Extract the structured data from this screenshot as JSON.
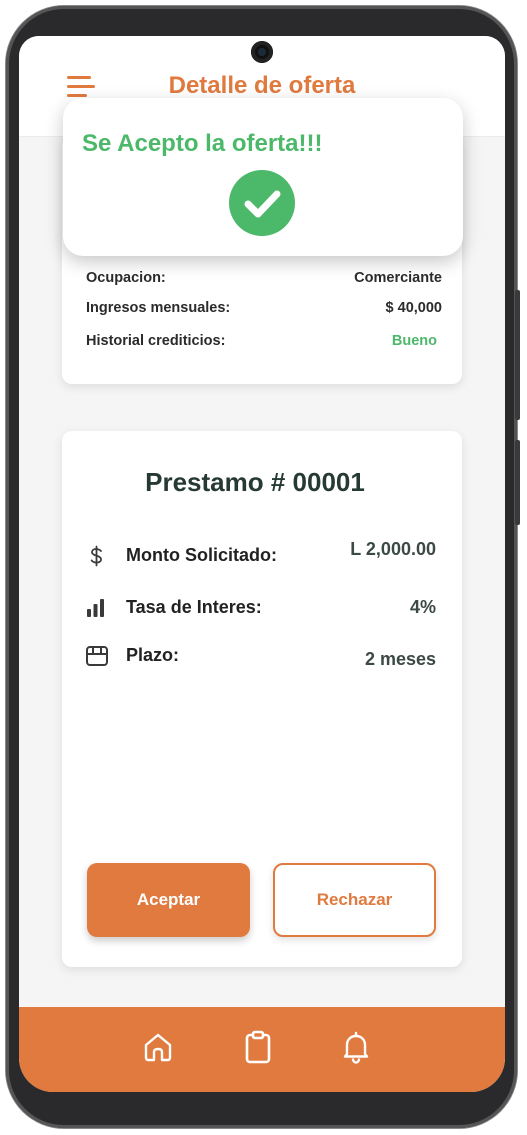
{
  "header": {
    "title": "Detalle de oferta"
  },
  "toast": {
    "message": "Se Acepto la oferta!!!"
  },
  "applicant": {
    "rows": [
      {
        "label": "Ocupacion:",
        "value": "Comerciante"
      },
      {
        "label": "Ingresos mensuales:",
        "value": "$ 40,000"
      },
      {
        "label": "Historial crediticios:",
        "value": "Bueno"
      }
    ]
  },
  "loan": {
    "title": "Prestamo # 00001",
    "rows": [
      {
        "icon": "dollar-icon",
        "label": "Monto Solicitado:",
        "value": "L 2,000.00"
      },
      {
        "icon": "bar-chart-icon",
        "label": "Tasa de Interes:",
        "value": "4%"
      },
      {
        "icon": "calendar-icon",
        "label": "Plazo:",
        "value": "2 meses"
      }
    ],
    "accept_label": "Aceptar",
    "reject_label": "Rechazar"
  },
  "nav": {
    "items": [
      "home-icon",
      "clipboard-icon",
      "bell-icon"
    ]
  },
  "colors": {
    "accent": "#e07a3f",
    "success": "#4cb86a",
    "frame": "#2a2a2c"
  }
}
